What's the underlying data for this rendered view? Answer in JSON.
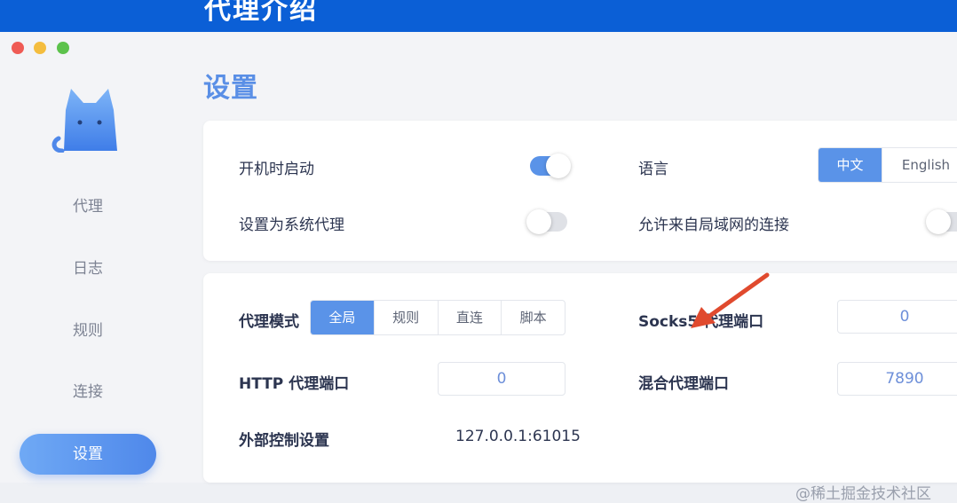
{
  "banner": {
    "title": "代理介绍"
  },
  "sidebar": {
    "items": [
      {
        "label": "代理"
      },
      {
        "label": "日志"
      },
      {
        "label": "规则"
      },
      {
        "label": "连接"
      },
      {
        "label": "设置"
      }
    ],
    "active_index": 4
  },
  "page": {
    "title": "设置"
  },
  "general": {
    "start_on_boot": {
      "label": "开机时启动",
      "enabled": true
    },
    "system_proxy": {
      "label": "设置为系统代理",
      "enabled": false
    },
    "language": {
      "label": "语言",
      "options": [
        "中文",
        "English"
      ],
      "selected": "中文"
    },
    "allow_lan": {
      "label": "允许来自局域网的连接",
      "enabled": false
    }
  },
  "proxy": {
    "mode": {
      "label": "代理模式",
      "options": [
        "全局",
        "规则",
        "直连",
        "脚本"
      ],
      "selected": "全局"
    },
    "socks5_port": {
      "label": "Socks5 代理端口",
      "value": "0"
    },
    "http_port": {
      "label": "HTTP 代理端口",
      "value": "0"
    },
    "mixed_port": {
      "label": "混合代理端口",
      "value": "7890"
    },
    "external_controller": {
      "label": "外部控制设置",
      "value": "127.0.0.1:61015"
    }
  },
  "watermark": "@稀土掘金技术社区",
  "colors": {
    "accent": "#5a93e8",
    "banner": "#0b5fd6",
    "arrow": "#e04a2e"
  }
}
